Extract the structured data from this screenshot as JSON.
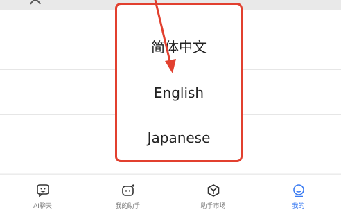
{
  "language_dialog": {
    "options": [
      {
        "label": "简体中文"
      },
      {
        "label": "English"
      },
      {
        "label": "Japanese"
      }
    ]
  },
  "tabbar": {
    "tabs": [
      {
        "label": "AI聊天",
        "icon": "chat-icon"
      },
      {
        "label": "我的助手",
        "icon": "assistant-icon"
      },
      {
        "label": "助手市场",
        "icon": "market-icon"
      },
      {
        "label": "我的",
        "icon": "profile-icon",
        "active": true
      }
    ]
  },
  "colors": {
    "accent": "#3a7bf2",
    "annotation": "#e2402f"
  }
}
